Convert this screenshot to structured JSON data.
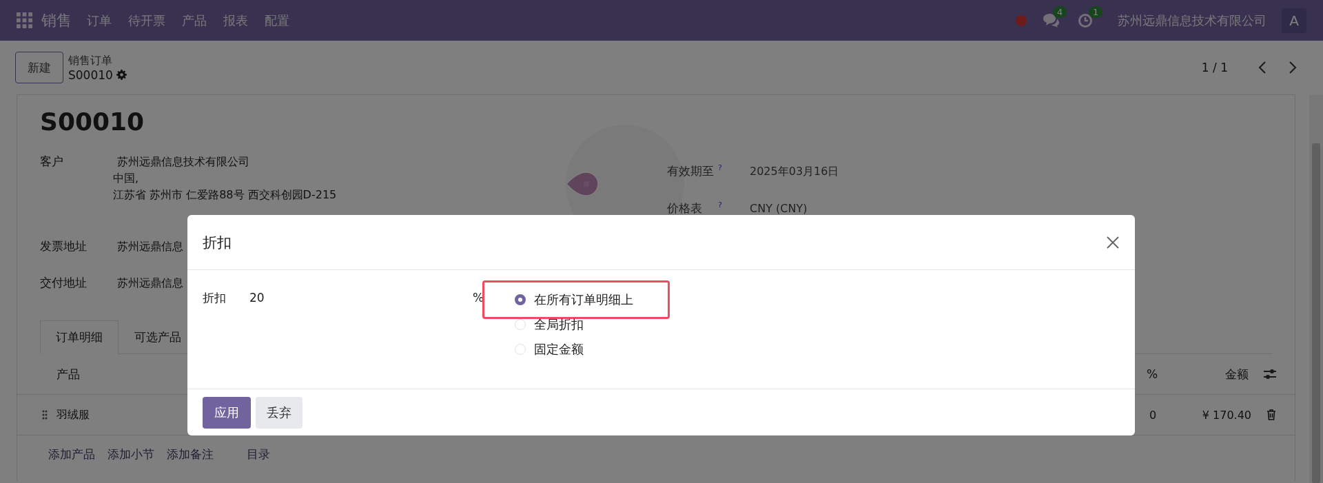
{
  "navbar": {
    "app": "销售",
    "menus": [
      "订单",
      "待开票",
      "产品",
      "报表",
      "配置"
    ],
    "messages_badge": "4",
    "activities_badge": "1",
    "company": "苏州远鼎信息技术有限公司",
    "avatar": "A"
  },
  "control_panel": {
    "new_button": "新建",
    "breadcrumb": "销售订单",
    "record": "S00010",
    "pager": "1 / 1"
  },
  "form": {
    "title": "S00010",
    "left_fields": [
      {
        "label": "客户",
        "lines": [
          "苏州远鼎信息技术有限公司",
          "中国,",
          "江苏省 苏州市 仁爱路88号 西交科创园D-215"
        ]
      },
      {
        "label": "发票地址",
        "lines": [
          "苏州远鼎信息"
        ]
      },
      {
        "label": "交付地址",
        "lines": [
          "苏州远鼎信息"
        ]
      }
    ],
    "right_fields": [
      {
        "label": "有效期至",
        "help": "?",
        "value": "2025年03月16日"
      },
      {
        "label": "价格表",
        "help": "?",
        "value": "CNY (CNY)"
      }
    ],
    "tabs": [
      {
        "label": "订单明细",
        "selected": true
      },
      {
        "label": "可选产品",
        "selected": false
      }
    ],
    "table": {
      "columns": [
        "产品",
        "%",
        "金额"
      ],
      "rows": [
        {
          "product": "羽绒服",
          "column_2": "0",
          "amount": "¥ 170.40"
        }
      ]
    },
    "add_links": [
      "添加产品",
      "添加小节",
      "添加备注",
      "目录"
    ]
  },
  "dialog": {
    "title": "折扣",
    "field_label": "折扣",
    "value": "20",
    "unit": "%",
    "options": [
      {
        "label": "在所有订单明细上",
        "selected": true,
        "highlighted": true
      },
      {
        "label": "全局折扣",
        "selected": false,
        "highlighted": false
      },
      {
        "label": "固定金额",
        "selected": false,
        "highlighted": false
      }
    ],
    "buttons": [
      {
        "label": "应用",
        "kind": "primary"
      },
      {
        "label": "丢弃",
        "kind": "secondary"
      }
    ]
  }
}
